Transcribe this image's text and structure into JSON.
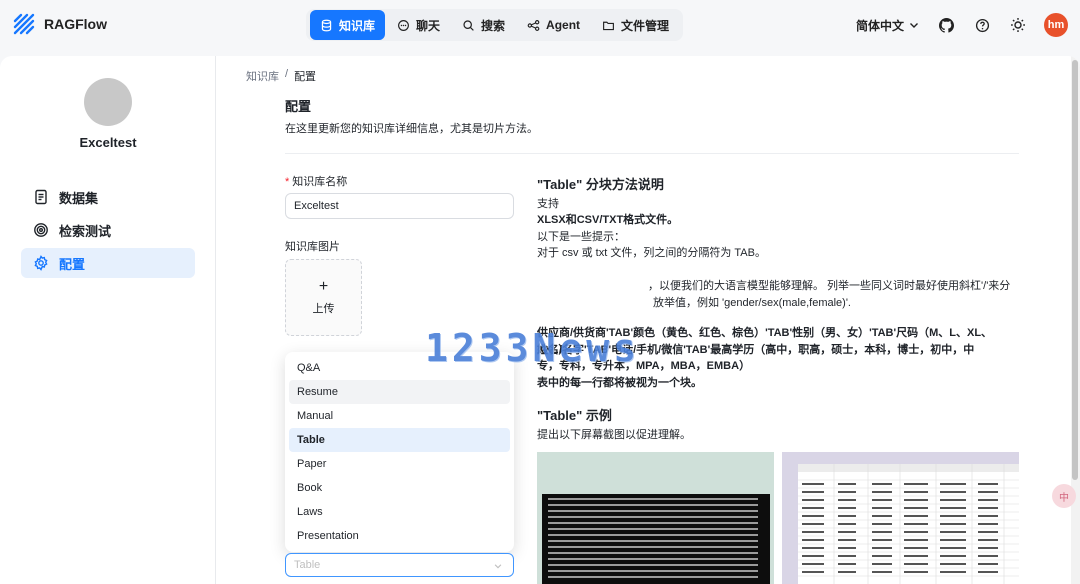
{
  "app": {
    "name": "RAGFlow"
  },
  "nav": [
    {
      "label": "知识库",
      "icon": "database-icon",
      "active": true
    },
    {
      "label": "聊天",
      "icon": "chat-icon"
    },
    {
      "label": "搜索",
      "icon": "search-icon"
    },
    {
      "label": "Agent",
      "icon": "agent-icon"
    },
    {
      "label": "文件管理",
      "icon": "folder-icon"
    }
  ],
  "header": {
    "language": "简体中文",
    "avatar_initials": "hm"
  },
  "sidebar": {
    "kb_name": "Exceltest",
    "items": [
      {
        "label": "数据集",
        "icon": "document-icon"
      },
      {
        "label": "检索测试",
        "icon": "target-icon"
      },
      {
        "label": "配置",
        "icon": "gear-icon",
        "active": true
      }
    ]
  },
  "breadcrumb": {
    "root": "知识库",
    "sep": "/",
    "current": "配置"
  },
  "page": {
    "title": "配置",
    "description": "在这里更新您的知识库详细信息，尤其是切片方法。"
  },
  "form": {
    "name_label": "知识库名称",
    "name_value": "Exceltest",
    "image_label": "知识库图片",
    "upload_plus": "+",
    "upload_label": "上传",
    "select_placeholder": "Table",
    "options": [
      "Q&A",
      "Resume",
      "Manual",
      "Table",
      "Paper",
      "Book",
      "Laws",
      "Presentation"
    ],
    "selected_option": "Table",
    "hovered_option": "Resume"
  },
  "explain": {
    "title": "\"Table\" 分块方法说明",
    "support": "支持",
    "formats": "XLSX和CSV/TXT格式文件。",
    "tips": "以下是一些提示：",
    "line1": "对于 csv 或 txt 文件，列之间的分隔符为 TAB。",
    "line2": "，以便我们的大语言模型能够理解。 列举一些同义词时最好使用斜杠'/'来分",
    "line3": "放举值，例如 'gender/sex(male,female)'.",
    "para1": "供应商/供货商'TAB'颜色（黄色、红色、棕色）'TAB'性别（男、女）'TAB'尺码（M、L、XL、XXL）",
    "para2": "姓名/名字'TAB'电话/手机/微信'TAB'最高学历（高中，职高，硕士，本科，博士，初中，中",
    "para3": "专，专科，专升本，MPA，MBA，EMBA）",
    "para4": "表中的每一行都将被视为一个块。",
    "example_title": "\"Table\" 示例",
    "example_desc": "提出以下屏幕截图以促进理解。"
  },
  "watermark": "1233News",
  "float_badge": "中",
  "colors": {
    "primary": "#1677ff",
    "avatar": "#e8512b",
    "required": "#f5222d"
  }
}
